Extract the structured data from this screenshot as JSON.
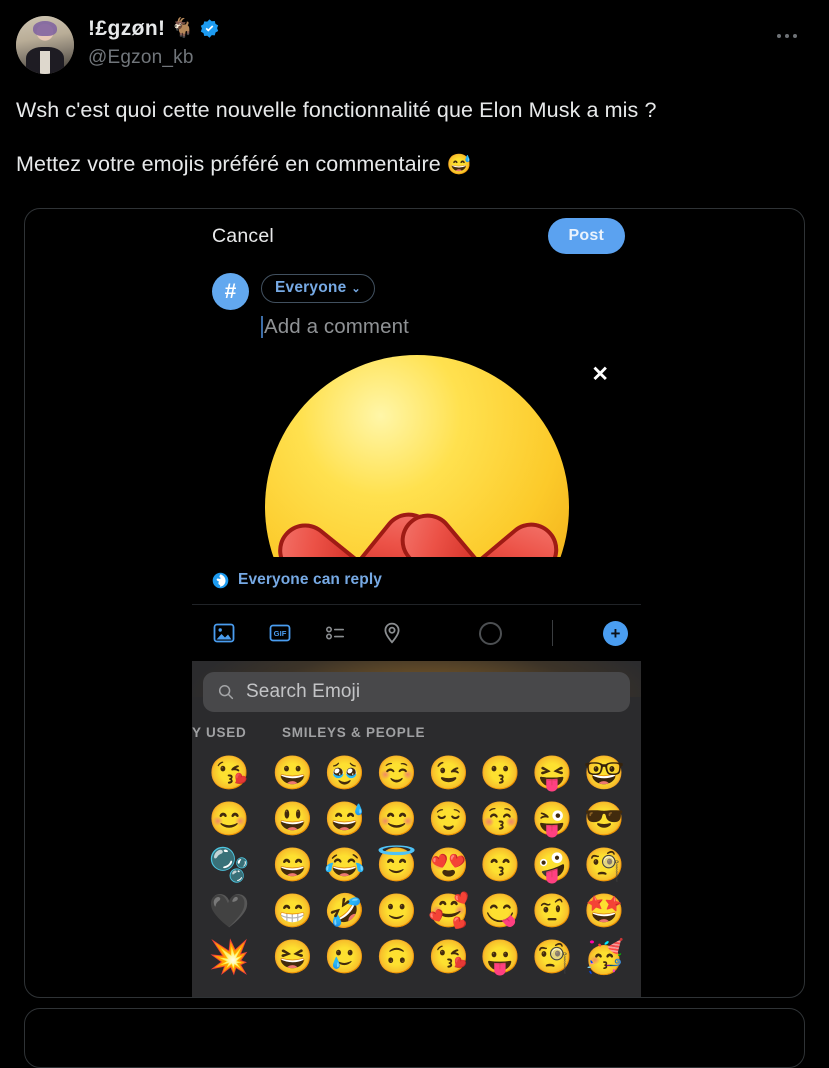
{
  "tweet": {
    "display_name": "!£gzøn!",
    "name_emoji": "🐐",
    "verified_badge": "verified-badge",
    "handle": "@Egzon_kb",
    "text_line_1": "Wsh c'est quoi cette nouvelle fonctionnalité que Elon Musk a mis ?",
    "text_line_2": "Mettez votre emojis préféré en commentaire",
    "text_line_2_emoji": "😅",
    "more_options": "•••"
  },
  "embedded_screenshot": {
    "compose": {
      "cancel_label": "Cancel",
      "post_label": "Post",
      "avatar_glyph": "#",
      "audience_label": "Everyone",
      "audience_chevron": "⌄",
      "comment_placeholder": "Add a comment",
      "attached_media_alt": "heart-eyes-emoji",
      "remove_media_glyph": "✕"
    },
    "reply_setting": {
      "icon": "globe-icon",
      "label": "Everyone can reply"
    },
    "toolbar": {
      "items": [
        {
          "name": "image-icon",
          "label": "Image"
        },
        {
          "name": "gif-icon",
          "label": "GIF"
        },
        {
          "name": "poll-icon",
          "label": "Poll"
        },
        {
          "name": "location-icon",
          "label": "Location"
        }
      ],
      "character_counter": "counter-ring",
      "add_post_glyph": "+"
    },
    "emoji_keyboard": {
      "search_placeholder": "Search Emoji",
      "category_recent": "Y USED",
      "category_smileys": "SMILEYS & PEOPLE",
      "recently_used": [
        "😘",
        "😊",
        "🫧",
        "🖤",
        "💥"
      ],
      "smileys_rows": [
        [
          "😀",
          "🥹",
          "☺️",
          "😉",
          "😗",
          "😝",
          "🤓"
        ],
        [
          "😃",
          "😅",
          "😊",
          "😌",
          "😚",
          "😜",
          "😎"
        ],
        [
          "😄",
          "😂",
          "😇",
          "😍",
          "😙",
          "🤪",
          "🧐"
        ],
        [
          "😁",
          "🤣",
          "🙂",
          "🥰",
          "😋",
          "🤨",
          "🤩"
        ],
        [
          "😆",
          "🥲",
          "🙃",
          "😘",
          "😛",
          "🧐",
          "🥳"
        ]
      ]
    }
  }
}
